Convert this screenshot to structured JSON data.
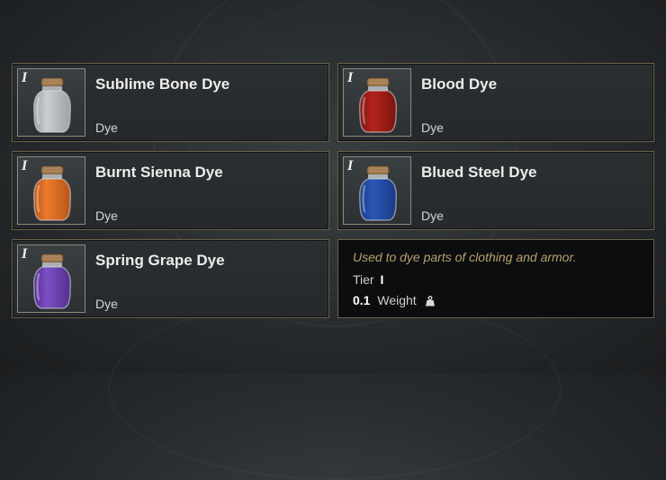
{
  "items": [
    {
      "tier": "I",
      "name": "Sublime Bone Dye",
      "type": "Dye",
      "color": "#c9ccd0",
      "color_dark": "#9fa3a8"
    },
    {
      "tier": "I",
      "name": "Blood Dye",
      "type": "Dye",
      "color": "#b3241b",
      "color_dark": "#7c1410"
    },
    {
      "tier": "I",
      "name": "Burnt Sienna Dye",
      "type": "Dye",
      "color": "#ec7a2c",
      "color_dark": "#b8551a"
    },
    {
      "tier": "I",
      "name": "Blued Steel Dye",
      "type": "Dye",
      "color": "#2a57b8",
      "color_dark": "#1a3a85"
    },
    {
      "tier": "I",
      "name": "Spring Grape Dye",
      "type": "Dye",
      "color": "#7b4fc6",
      "color_dark": "#54308f"
    }
  ],
  "tooltip": {
    "description": "Used to dye parts of clothing and armor.",
    "tier_label": "Tier",
    "tier_value": "I",
    "weight_value": "0.1",
    "weight_label": "Weight",
    "weight_icon": "weight-icon"
  }
}
